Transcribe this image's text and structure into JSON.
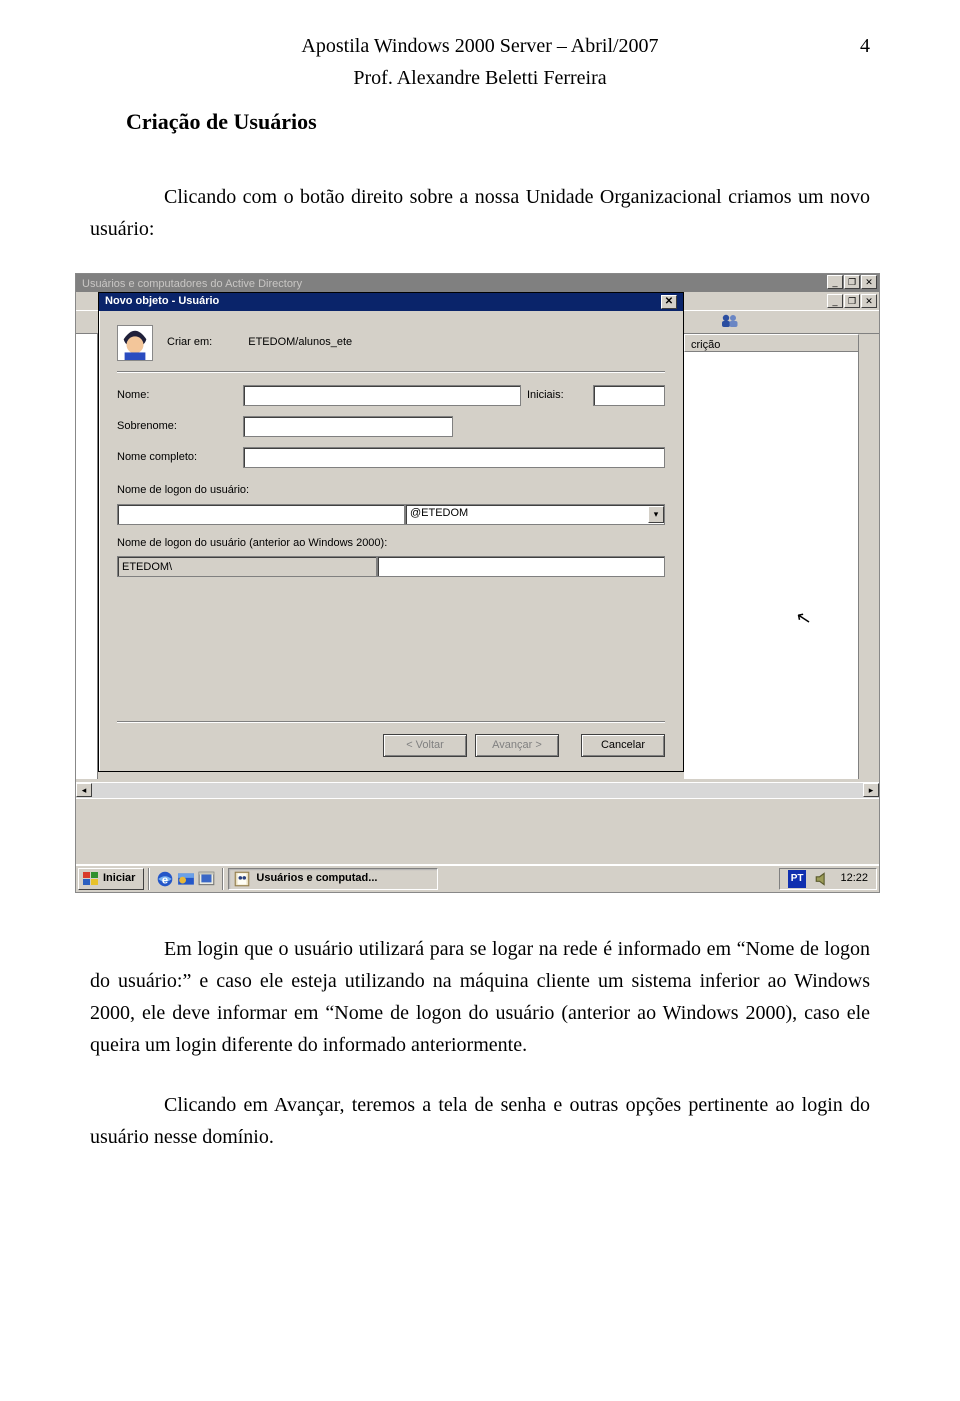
{
  "header": {
    "line1": "Apostila Windows 2000 Server – Abril/2007",
    "line2": "Prof. Alexandre Beletti Ferreira",
    "page_number": "4"
  },
  "section_heading": "Criação de Usuários",
  "para1": "Clicando com o botão direito sobre a nossa Unidade Organizacional criamos um novo usuário:",
  "para2": "Em login que o usuário utilizará para se logar na rede é informado em “Nome de logon do usuário:” e caso ele esteja utilizando na máquina cliente um sistema inferior ao Windows 2000, ele deve informar em “Nome de logon do usuário (anterior ao Windows 2000), caso ele queira um login diferente do informado anteriormente.",
  "para3": "Clicando em Avançar, teremos a tela de senha e outras opções pertinente ao login do usuário nesse domínio.",
  "screenshot": {
    "bg_window_title": "Usuários e computadores do Active Directory",
    "list_header": "crição",
    "dialog": {
      "title": "Novo objeto - Usuário",
      "criar_label": "Criar em:",
      "criar_path": "ETEDOM/alunos_ete",
      "nome_label": "Nome:",
      "iniciais_label": "Iniciais:",
      "sobrenome_label": "Sobrenome:",
      "nome_completo_label": "Nome completo:",
      "logon_label": "Nome de logon do usuário:",
      "domain_suffix": "@ETEDOM",
      "logon_pre2000_label": "Nome de logon do usuário (anterior ao Windows 2000):",
      "domain_prefix": "ETEDOM\\",
      "btn_back": "< Voltar",
      "btn_next": "Avançar >",
      "btn_cancel": "Cancelar"
    },
    "taskbar": {
      "start": "Iniciar",
      "task_label": "Usuários e computad...",
      "lang": "PT",
      "clock": "12:22"
    }
  }
}
